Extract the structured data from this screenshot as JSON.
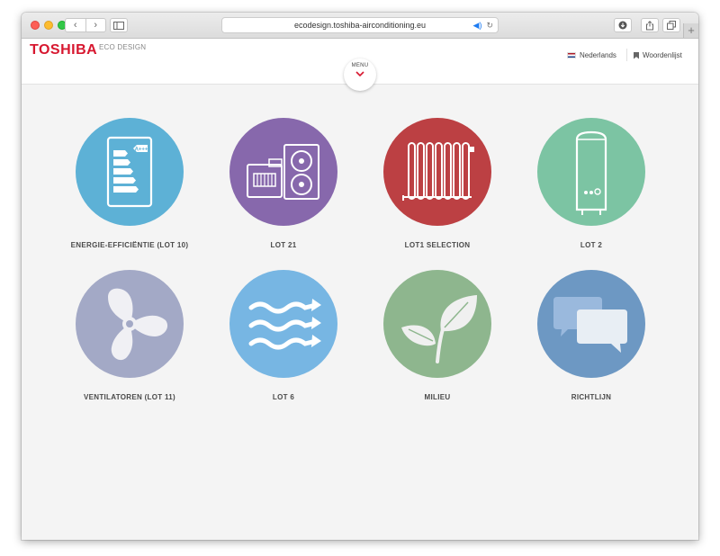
{
  "browser": {
    "url": "ecodesign.toshiba-airconditioning.eu",
    "new_tab_label": "+"
  },
  "header": {
    "brand": "TOSHIBA",
    "brand_sub": "ECO DESIGN",
    "menu_label": "MENU",
    "language": "Nederlands",
    "glossary": "Woordenlijst"
  },
  "tiles": [
    {
      "label": "ENERGIE-EFFICIËNTIE (LOT 10)",
      "color": "#5db1d6",
      "icon": "energy-label-icon",
      "badge": "A+++"
    },
    {
      "label": "LOT 21",
      "color": "#8768ac",
      "icon": "outdoor-unit-icon"
    },
    {
      "label": "LOT1 SELECTION",
      "color": "#bc4043",
      "icon": "radiator-icon"
    },
    {
      "label": "LOT 2",
      "color": "#7cc4a3",
      "icon": "water-heater-icon"
    },
    {
      "label": "VENTILATOREN (LOT 11)",
      "color": "#a3a9c6",
      "icon": "fan-icon"
    },
    {
      "label": "LOT 6",
      "color": "#77b6e3",
      "icon": "airflow-icon"
    },
    {
      "label": "MILIEU",
      "color": "#8eb68e",
      "icon": "leaf-icon"
    },
    {
      "label": "RICHTLIJN",
      "color": "#6d98c3",
      "icon": "chat-bubbles-icon"
    }
  ]
}
